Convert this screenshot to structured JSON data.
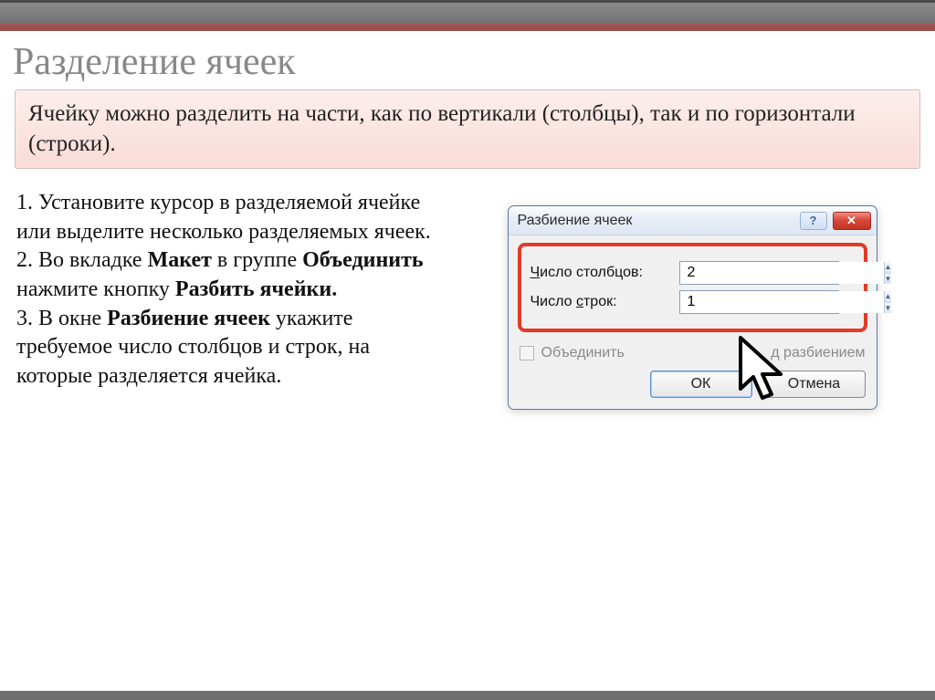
{
  "slide": {
    "title": "Разделение ячеек",
    "highlight": "Ячейку можно разделить на части, как по вертикали (столбцы), так и по горизонтали (строки).",
    "steps": {
      "s1": "1. Установите курсор в разделяемой ячейке или выделите несколько разделяемых ячеек.",
      "s2a": "2. Во вкладке ",
      "s2b": "Макет",
      "s2c": " в группе ",
      "s2d": "Объединить",
      "s2e": " нажмите кнопку ",
      "s2f": "Разбить ячейки.",
      "s3a": "3. В окне ",
      "s3b": "Разбиение ячеек",
      "s3c": "  укажите требуемое число столбцов и строк, на которые разделяется ячейка."
    }
  },
  "dialog": {
    "title": "Разбиение ячеек",
    "help_symbol": "?",
    "close_symbol": "✕",
    "columns_label_u": "Ч",
    "columns_label_rest": "исло столбцов:",
    "rows_label": "Число ",
    "rows_label_u": "с",
    "rows_label_rest": "трок:",
    "columns_value": "2",
    "rows_value": "1",
    "merge_before_a": "Объединить ",
    "merge_before_b": "д разбиением",
    "ok": "ОК",
    "cancel": "Отмена"
  }
}
